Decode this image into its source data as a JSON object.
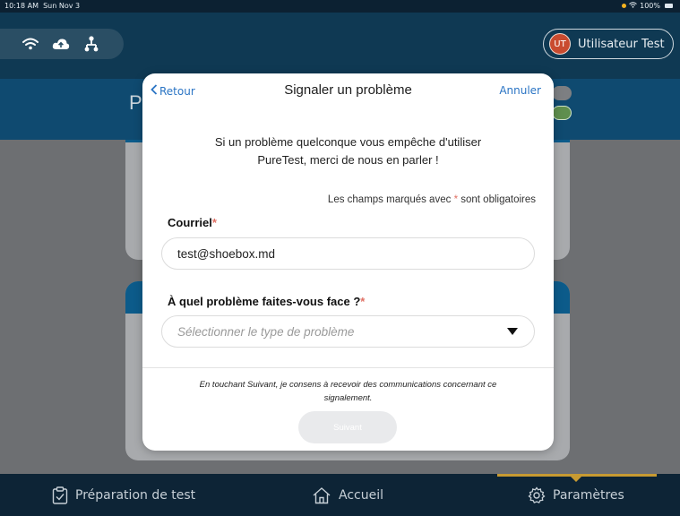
{
  "status_bar": {
    "time": "10:18 AM",
    "date": "Sun Nov 3",
    "battery": "100%"
  },
  "header": {
    "connectivity_icons": [
      "wifi-icon",
      "cloud-upload-icon",
      "network-icon"
    ],
    "user": {
      "initials": "UT",
      "name": "Utilisateur Test"
    }
  },
  "page": {
    "title_visible_fragment": "P"
  },
  "modal": {
    "back_label": "Retour",
    "title": "Signaler un problème",
    "cancel_label": "Annuler",
    "intro_line1": "Si un problème quelconque vous empêche d'utiliser",
    "intro_line2": "PureTest, merci de nous en parler !",
    "required_note_prefix": "Les champs marqués avec",
    "required_star": "*",
    "required_note_suffix": "sont obligatoires",
    "email_label": "Courriel",
    "email_value": "test@shoebox.md",
    "problem_label": "À quel problème faites-vous face ?",
    "problem_placeholder": "Sélectionner le type de problème",
    "consent_line1": "En touchant Suivant, je consens à recevoir des communications concernant ce",
    "consent_line2": "signalement.",
    "next_label": "Suivant"
  },
  "tabbar": {
    "tabs": [
      {
        "label": "Préparation de test",
        "icon": "clipboard-check-icon"
      },
      {
        "label": "Accueil",
        "icon": "home-icon"
      },
      {
        "label": "Paramètres",
        "icon": "gear-icon",
        "active": true
      }
    ]
  },
  "colors": {
    "accent_blue": "#2a74c4",
    "required_red": "#e07064",
    "tab_active": "#c79a32",
    "header_navy": "#0f3953",
    "band_blue": "#0f4a70"
  }
}
